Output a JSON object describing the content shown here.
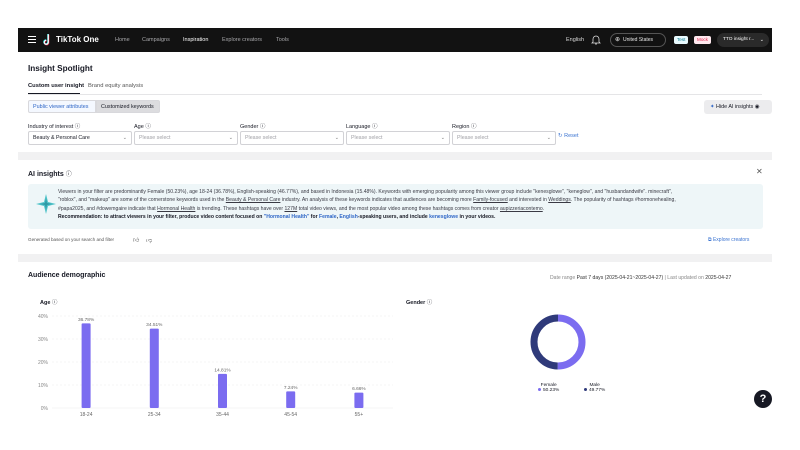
{
  "topbar": {
    "logo_text": "TikTok One",
    "nav": [
      "Home",
      "Campaigns",
      "Inspiration",
      "Explore creators",
      "Tools"
    ],
    "active_nav": "Inspiration",
    "language": "English",
    "region": "United States",
    "badge_test": "Test",
    "badge_mock": "Mock",
    "account": "TTO insight r..."
  },
  "header": {
    "title": "Insight Spotlight",
    "tabs": [
      "Custom user insight",
      "Brand equity analysis"
    ],
    "segments": [
      "Public viewer attributes",
      "Customized keywords"
    ],
    "hide_ai_label": "Hide AI insights",
    "filters": [
      {
        "label": "Industry of interest",
        "value": "Beauty & Personal Care"
      },
      {
        "label": "Age",
        "value": "Please select"
      },
      {
        "label": "Gender",
        "value": "Please select"
      },
      {
        "label": "Language",
        "value": "Please select"
      },
      {
        "label": "Region",
        "value": "Please select"
      }
    ],
    "reset_label": "Reset"
  },
  "ai": {
    "title": "AI insights",
    "p1": "Viewers in your filter are predominantly Female (50.23%), age 18-24 (36.78%), English-speaking (46.77%), and based in Indonesia (15.48%). Keywords with emerging popularity among this viewer group include \"kenesglowe\", \"keneglow\", and \"husbandandwife\". minecraft\",",
    "p2a": "\"roblox\", and \"makeup\" are some of the cornerstone keywords used in the ",
    "p2_link": "Beauty & Personal Care",
    "p2b": " industry. An analysis of these keywords indicates that audiences are becoming more ",
    "p2_link2": "Family-focused",
    "p2c": " and interested in ",
    "p2_link3": "Weddings",
    "p2d": ". The popularity of hashtags #hormonehealing,",
    "p3a": "#papa2025, and #dowemgaire indicate that ",
    "p3_link": "Hormonal Health",
    "p3b": " is trending. These hashtags have over ",
    "p3_link2": "127M",
    "p3c": " total video views, and the most popular video among these hashtags comes from creator ",
    "p3_link3": "aupizzeriacontemo",
    "p3d": ".",
    "rec_label": "Recommendation:",
    "rec_a": " to attract viewers in your filter, produce video content focused on ",
    "rec_topic": "\"Hormonal Health\"",
    "rec_b": " for ",
    "rec_gender": "Female",
    "rec_c": ", ",
    "rec_lang": "English",
    "rec_d": "-speaking users, and include ",
    "rec_kw": "kenesglowe",
    "rec_e": " in your videos.",
    "footer": "Generated based on your search and filter",
    "explore_label": "Explore creators"
  },
  "audience": {
    "title": "Audience demographic",
    "range_label": "Date range",
    "range_value": "Past 7 days (2025-04-21~2025-04-27)",
    "updated_label": " | Last updated on ",
    "updated_value": "2025-04-27",
    "age_title": "Age",
    "gender_title": "Gender"
  },
  "chart_data": [
    {
      "type": "bar",
      "title": "Age",
      "categories": [
        "18-24",
        "25-34",
        "35-44",
        "45-54",
        "55+"
      ],
      "values": [
        36.78,
        34.51,
        14.81,
        7.24,
        6.66
      ],
      "value_labels": [
        "36.78%",
        "34.51%",
        "14.81%",
        "7.24%",
        "6.66%"
      ],
      "yticks": [
        "0%",
        "10%",
        "20%",
        "30%",
        "40%"
      ],
      "ylim": [
        0,
        40
      ],
      "color": "#7b6cf0"
    },
    {
      "type": "pie",
      "title": "Gender",
      "labels": [
        "Female",
        "Male"
      ],
      "values": [
        50.23,
        49.77
      ],
      "value_labels": [
        "50.23%",
        "49.77%"
      ],
      "colors": [
        "#7b6cf0",
        "#2f3a7a"
      ]
    }
  ]
}
